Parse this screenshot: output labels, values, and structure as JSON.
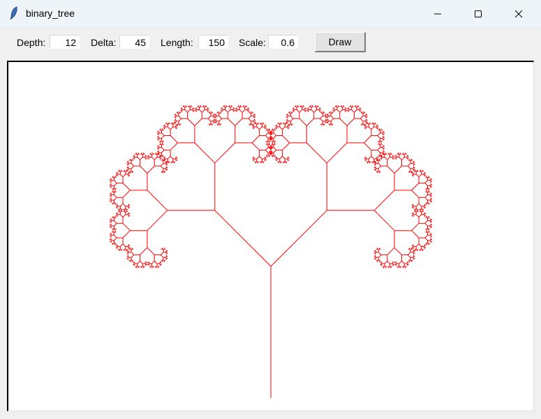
{
  "window": {
    "title": "binary_tree"
  },
  "toolbar": {
    "depth_label": "Depth:",
    "depth_value": "12",
    "delta_label": "Delta:",
    "delta_value": "45",
    "length_label": "Length:",
    "length_value": "150",
    "scale_label": "Scale:",
    "scale_value": "0.6",
    "draw_label": "Draw"
  },
  "tree": {
    "depth": 12,
    "delta_deg": 45,
    "length": 150,
    "scale": 0.6,
    "color": "#ff0000"
  }
}
